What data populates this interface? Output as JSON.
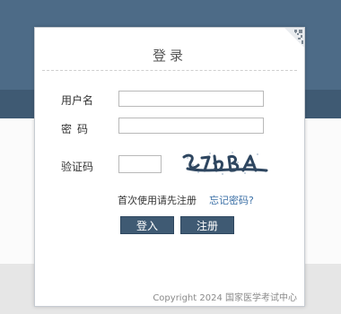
{
  "dialog": {
    "title": "登录",
    "username_label": "用户名",
    "username_value": "",
    "password_label": "密码",
    "password_value": "",
    "captcha_label": "验证码",
    "captcha_value": "",
    "captcha_image_icon": "captcha-image",
    "qr_icon": "qr-code-icon",
    "first_use_text": "首次使用请先注册",
    "forgot_link": "忘记密码?",
    "login_button": "登入",
    "register_button": "注册",
    "copyright": "Copyright 2024 国家医学考试中心"
  },
  "colors": {
    "header_bg": "#4d6b87",
    "button_bg": "#3f5a73",
    "link": "#3b6fa6"
  }
}
